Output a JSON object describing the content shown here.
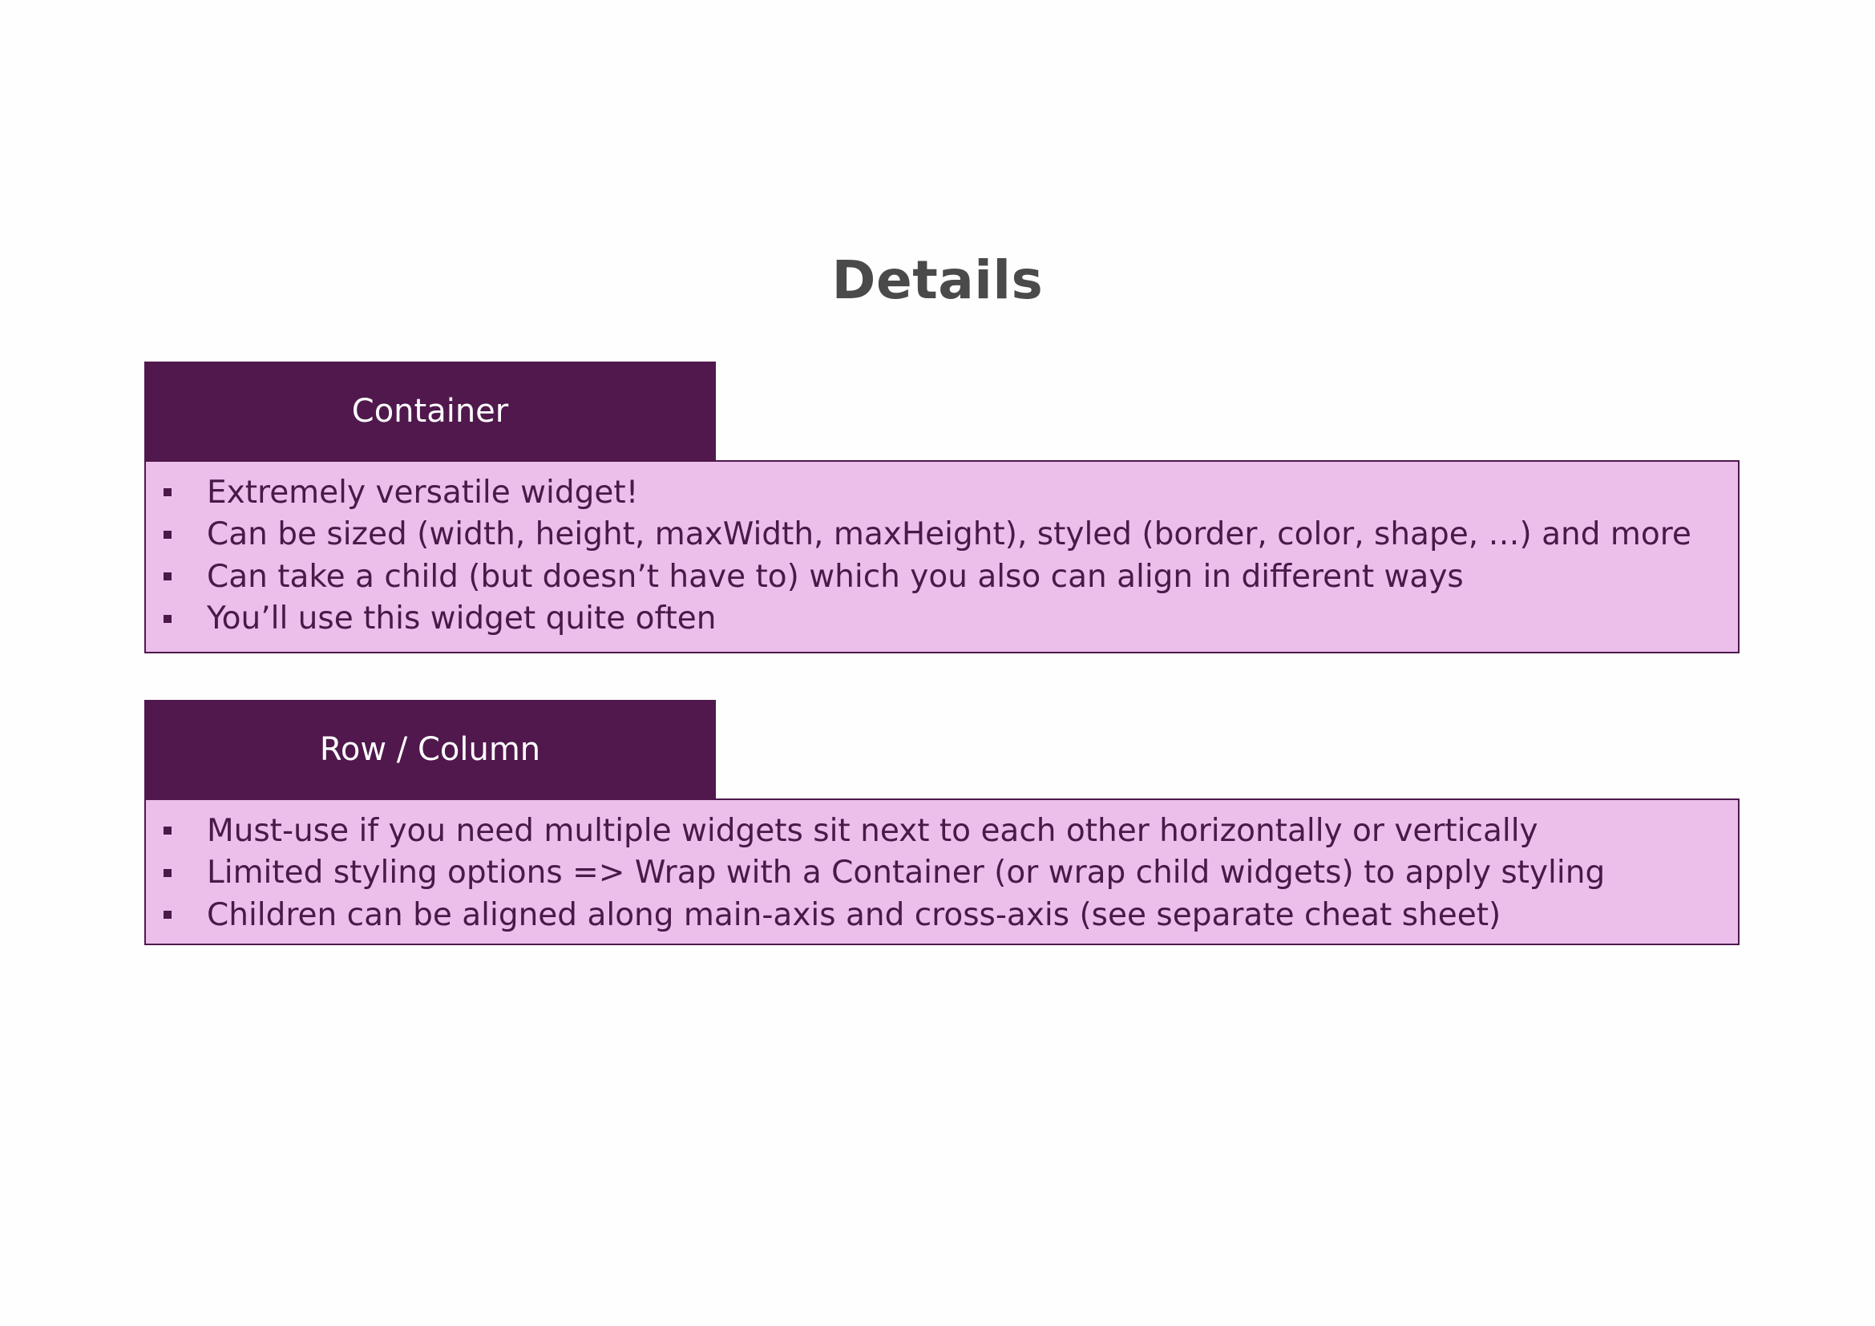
{
  "page": {
    "title": "Details"
  },
  "colors": {
    "header_bg": "#50184d",
    "header_text": "#ffffff",
    "body_bg": "#ebbfea",
    "body_border": "#50184d",
    "body_text": "#4a1947",
    "bullet": "#4a1947",
    "title": "#4a4a4a"
  },
  "sections": [
    {
      "header": "Container",
      "items": [
        "Extremely versatile widget!",
        "Can be sized (width, height, maxWidth, maxHeight), styled (border, color, shape, …) and more",
        "Can take a child (but doesn’t have to) which you also can align in different ways",
        "You’ll use this widget quite often"
      ]
    },
    {
      "header": "Row / Column",
      "items": [
        "Must-use if you need multiple widgets sit next to each other horizontally or vertically",
        "Limited styling options => Wrap with a Container (or wrap child widgets) to apply styling",
        "Children can be aligned along main-axis and cross-axis (see separate cheat sheet)"
      ]
    }
  ]
}
